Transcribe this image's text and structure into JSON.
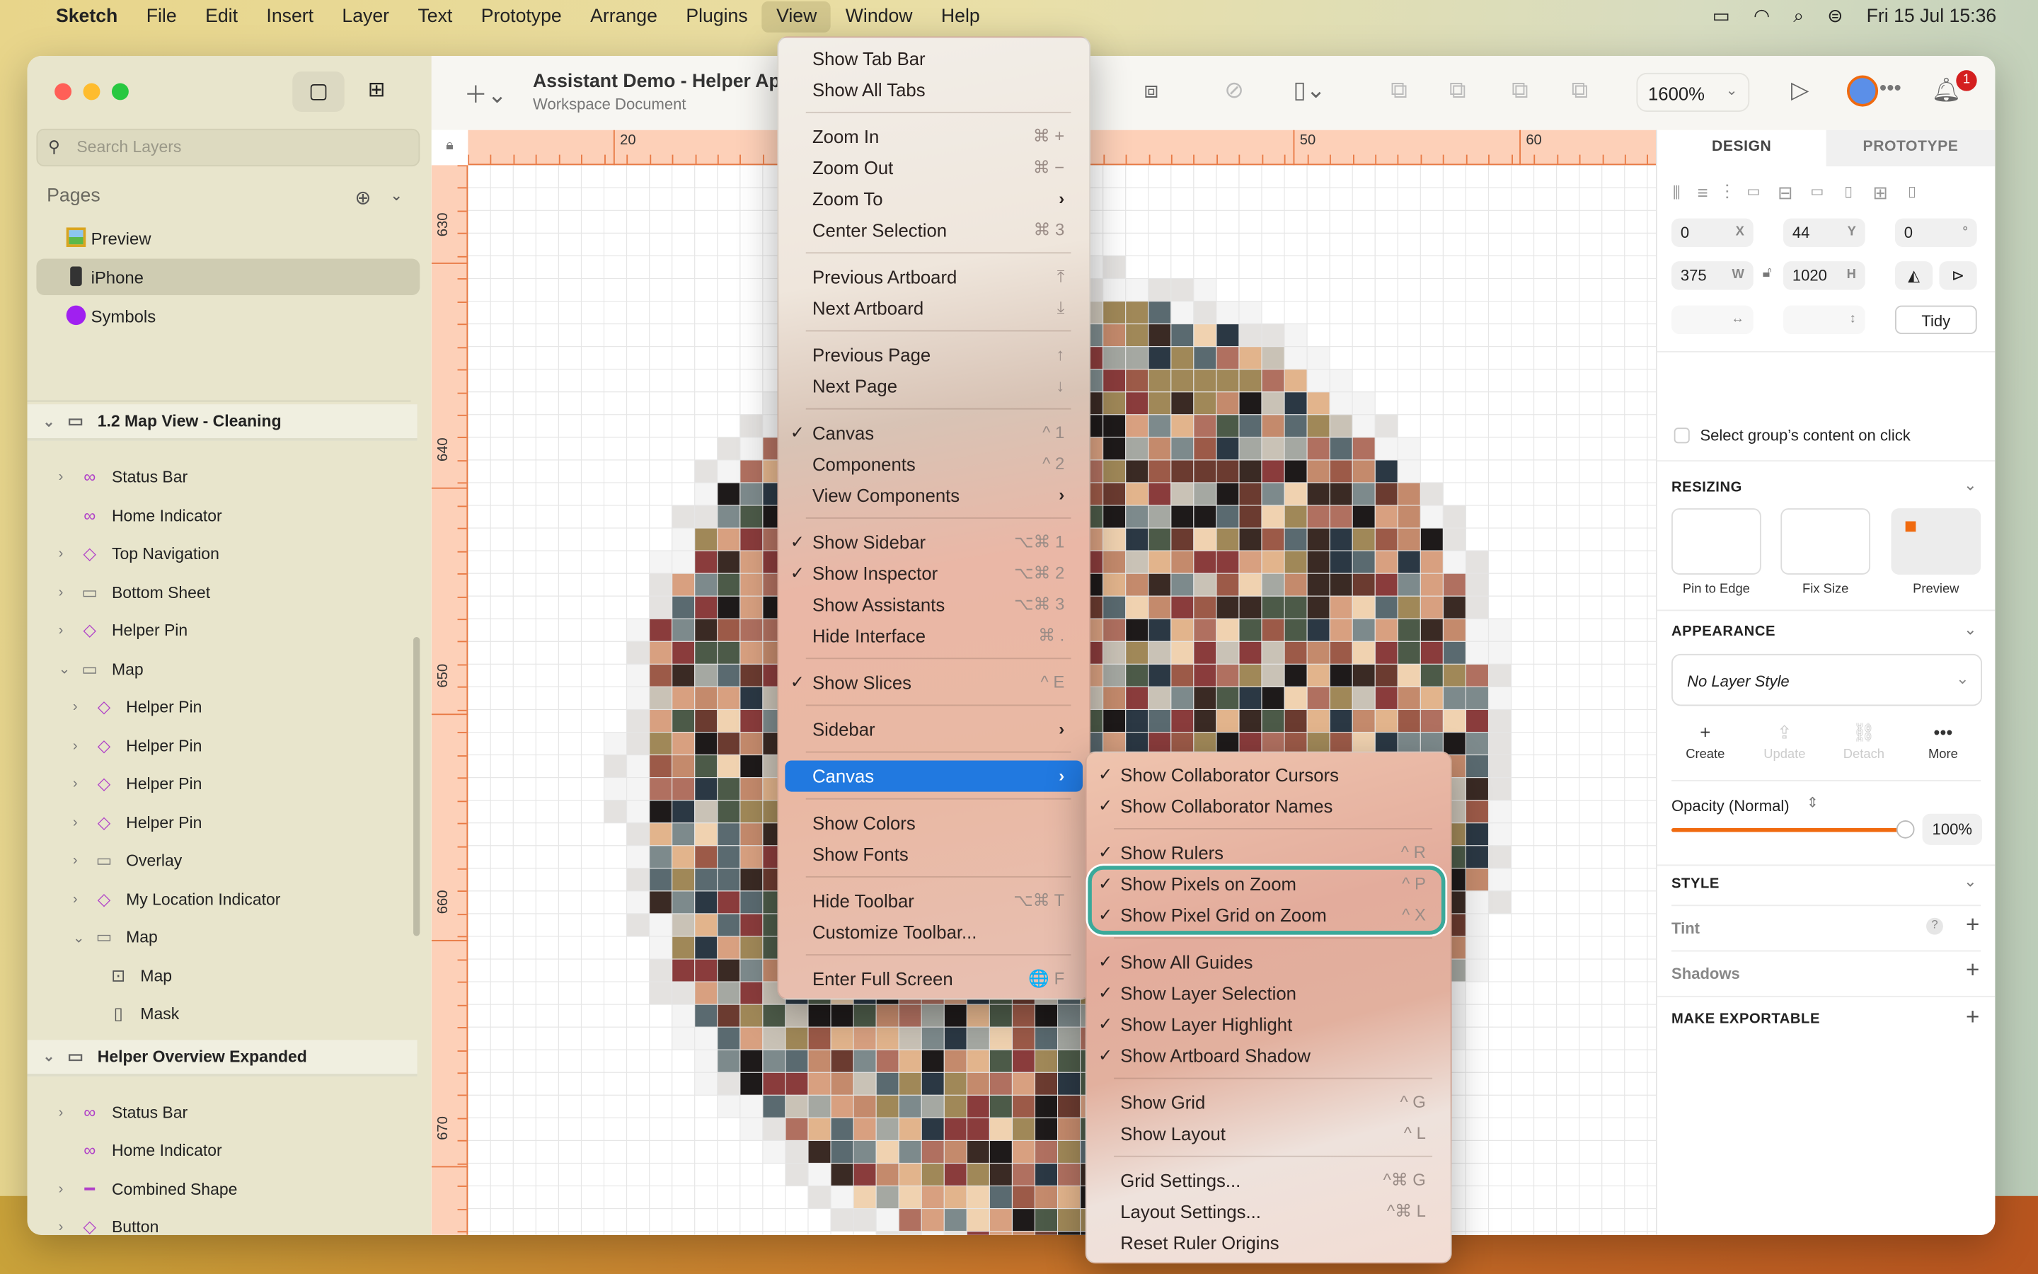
{
  "menubar": {
    "app": "Sketch",
    "items": [
      "File",
      "Edit",
      "Insert",
      "Layer",
      "Text",
      "Prototype",
      "Arrange",
      "Plugins",
      "View",
      "Window",
      "Help"
    ],
    "active": "View",
    "clock": "Fri 15 Jul  15:36"
  },
  "window": {
    "title": "Assistant Demo - Helper Ap",
    "subtitle": "Workspace Document",
    "zoom": "1600%",
    "notification_count": "1"
  },
  "sidebar": {
    "search_placeholder": "Search Layers",
    "pages_label": "Pages",
    "pages": [
      {
        "label": "Preview",
        "icon": "framed-picture-icon"
      },
      {
        "label": "iPhone",
        "icon": "iphone-icon",
        "selected": true
      },
      {
        "label": "Symbols",
        "icon": "purple-circle-icon"
      }
    ],
    "layers": [
      {
        "label": "1.2 Map View - Cleaning",
        "icon": "artboard",
        "depth": 0,
        "chev": "down",
        "header": true
      },
      {
        "label": "Status Bar",
        "icon": "symbol",
        "depth": 1,
        "chev": "right"
      },
      {
        "label": "Home Indicator",
        "icon": "symbol",
        "depth": 1,
        "chev": ""
      },
      {
        "label": "Top Navigation",
        "icon": "component",
        "depth": 1,
        "chev": "right"
      },
      {
        "label": "Bottom Sheet",
        "icon": "folder",
        "depth": 1,
        "chev": "right"
      },
      {
        "label": "Helper Pin",
        "icon": "component",
        "depth": 1,
        "chev": "right"
      },
      {
        "label": "Map",
        "icon": "folder",
        "depth": 1,
        "chev": "down"
      },
      {
        "label": "Helper Pin",
        "icon": "component",
        "depth": 2,
        "chev": "right"
      },
      {
        "label": "Helper Pin",
        "icon": "component",
        "depth": 2,
        "chev": "right"
      },
      {
        "label": "Helper Pin",
        "icon": "component",
        "depth": 2,
        "chev": "right"
      },
      {
        "label": "Helper Pin",
        "icon": "component",
        "depth": 2,
        "chev": "right"
      },
      {
        "label": "Overlay",
        "icon": "folder",
        "depth": 2,
        "chev": "right"
      },
      {
        "label": "My Location Indicator",
        "icon": "component",
        "depth": 2,
        "chev": "right"
      },
      {
        "label": "Map",
        "icon": "folder",
        "depth": 2,
        "chev": "down"
      },
      {
        "label": "Map",
        "icon": "image",
        "depth": 3,
        "chev": ""
      },
      {
        "label": "Mask",
        "icon": "mask",
        "depth": 3,
        "chev": ""
      },
      {
        "label": "Helper Overview Expanded",
        "icon": "artboard",
        "depth": 0,
        "chev": "down",
        "header": true
      },
      {
        "label": "Status Bar",
        "icon": "symbol",
        "depth": 1,
        "chev": "right"
      },
      {
        "label": "Home Indicator",
        "icon": "symbol",
        "depth": 1,
        "chev": ""
      },
      {
        "label": "Combined Shape",
        "icon": "shape",
        "depth": 1,
        "chev": "right"
      },
      {
        "label": "Button",
        "icon": "component",
        "depth": 1,
        "chev": "right"
      }
    ]
  },
  "rulers": {
    "top": [
      "20",
      "50",
      "60"
    ],
    "left": [
      "630",
      "640",
      "650",
      "660",
      "670"
    ]
  },
  "view_menu": [
    {
      "label": "Show Tab Bar"
    },
    {
      "label": "Show All Tabs"
    },
    {
      "sep": true
    },
    {
      "label": "Zoom In",
      "shortcut": "⌘ +"
    },
    {
      "label": "Zoom Out",
      "shortcut": "⌘ −"
    },
    {
      "label": "Zoom To",
      "submenu": true
    },
    {
      "label": "Center Selection",
      "shortcut": "⌘ 3"
    },
    {
      "sep": true
    },
    {
      "label": "Previous Artboard",
      "shortcut": "⤒"
    },
    {
      "label": "Next Artboard",
      "shortcut": "⤓"
    },
    {
      "sep": true
    },
    {
      "label": "Previous Page",
      "shortcut": "↑"
    },
    {
      "label": "Next Page",
      "shortcut": "↓"
    },
    {
      "sep": true
    },
    {
      "label": "Canvas",
      "shortcut": "^ 1",
      "checked": true
    },
    {
      "label": "Components",
      "shortcut": "^ 2"
    },
    {
      "label": "View Components",
      "submenu": true
    },
    {
      "sep": true
    },
    {
      "label": "Show Sidebar",
      "shortcut": "⌥⌘ 1",
      "checked": true
    },
    {
      "label": "Show Inspector",
      "shortcut": "⌥⌘ 2",
      "checked": true
    },
    {
      "label": "Show Assistants",
      "shortcut": "⌥⌘ 3"
    },
    {
      "label": "Hide Interface",
      "shortcut": "⌘ ."
    },
    {
      "sep": true
    },
    {
      "label": "Show Slices",
      "shortcut": "^ E",
      "checked": true
    },
    {
      "sep": true
    },
    {
      "label": "Sidebar",
      "submenu": true
    },
    {
      "sep": true
    },
    {
      "label": "Canvas",
      "submenu": true,
      "highlighted": true
    },
    {
      "sep": true
    },
    {
      "label": "Show Colors"
    },
    {
      "label": "Show Fonts"
    },
    {
      "sep": true
    },
    {
      "label": "Hide Toolbar",
      "shortcut": "⌥⌘ T"
    },
    {
      "label": "Customize Toolbar..."
    },
    {
      "sep": true
    },
    {
      "label": "Enter Full Screen",
      "shortcut": "🌐 F"
    }
  ],
  "canvas_menu": [
    {
      "label": "Show Collaborator Cursors",
      "checked": true
    },
    {
      "label": "Show Collaborator Names",
      "checked": true
    },
    {
      "sep": true
    },
    {
      "label": "Show Rulers",
      "shortcut": "^ R",
      "checked": true
    },
    {
      "label": "Show Pixels on Zoom",
      "shortcut": "^ P",
      "checked": true
    },
    {
      "label": "Show Pixel Grid on Zoom",
      "shortcut": "^ X",
      "checked": true
    },
    {
      "sep": true
    },
    {
      "label": "Show All Guides",
      "checked": true
    },
    {
      "label": "Show Layer Selection",
      "checked": true
    },
    {
      "label": "Show Layer Highlight",
      "checked": true
    },
    {
      "label": "Show Artboard Shadow",
      "checked": true
    },
    {
      "sep": true
    },
    {
      "label": "Show Grid",
      "shortcut": "^ G"
    },
    {
      "label": "Show Layout",
      "shortcut": "^ L"
    },
    {
      "sep": true
    },
    {
      "label": "Grid Settings...",
      "shortcut": "^⌘ G"
    },
    {
      "label": "Layout Settings...",
      "shortcut": "^⌘ L"
    },
    {
      "label": "Reset Ruler Origins"
    }
  ],
  "inspector": {
    "tabs": [
      "DESIGN",
      "PROTOTYPE"
    ],
    "x": "0",
    "x_unit": "X",
    "y": "44",
    "y_unit": "Y",
    "rotation": "0",
    "rotation_unit": "°",
    "w": "375",
    "w_unit": "W",
    "h": "1020",
    "h_unit": "H",
    "tidy": "Tidy",
    "select_group_content": "Select group’s content on click",
    "resizing": "RESIZING",
    "pin_to_edge": "Pin to Edge",
    "fix_size": "Fix Size",
    "preview": "Preview",
    "appearance": "APPEARANCE",
    "layer_style": "No Layer Style",
    "style_actions": [
      "Create",
      "Update",
      "Detach",
      "More"
    ],
    "opacity_label": "Opacity (Normal)",
    "opacity": "100%",
    "opacity_value": 1.0,
    "style": "STYLE",
    "tint": "Tint",
    "shadows": "Shadows",
    "make_exportable": "MAKE EXPORTABLE"
  },
  "colors": {
    "accent": "#2179e0",
    "ruler": "#e87a45",
    "highlight_callout": "#3aa99a",
    "opacity_slider": "#f06a0f"
  }
}
